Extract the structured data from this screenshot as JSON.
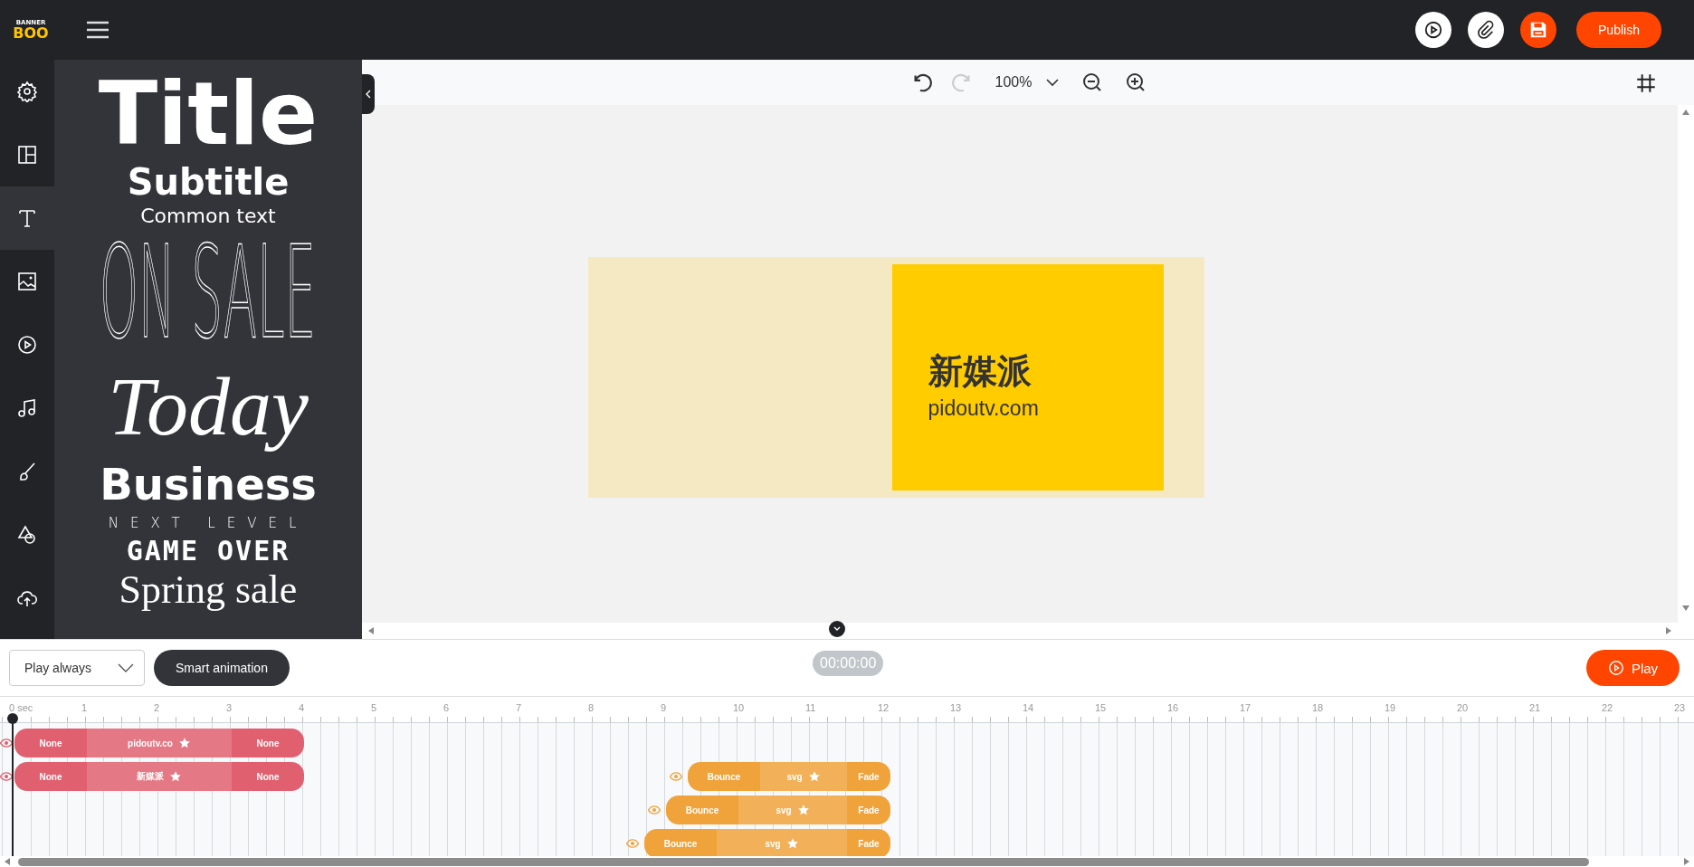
{
  "logo": {
    "line_1": "BANNER",
    "line_2": "BOO"
  },
  "top_bar": {
    "actions": [
      {
        "kind": "preview"
      },
      {
        "kind": "link"
      },
      {
        "kind": "save"
      }
    ],
    "publish": "Publish"
  },
  "rail": [
    {
      "kind": "settings",
      "selected": false
    },
    {
      "kind": "layout",
      "selected": false
    },
    {
      "kind": "text",
      "selected": true
    },
    {
      "kind": "image",
      "selected": false
    },
    {
      "kind": "video",
      "selected": false
    },
    {
      "kind": "music",
      "selected": false
    },
    {
      "kind": "brush",
      "selected": false
    },
    {
      "kind": "shapes",
      "selected": false
    },
    {
      "kind": "upload",
      "selected": false
    }
  ],
  "text_panel": {
    "samples": [
      {
        "kind": "title",
        "text": "Title"
      },
      {
        "kind": "subtitle",
        "text": "Subtitle"
      },
      {
        "kind": "common",
        "text": "Common text"
      },
      {
        "kind": "thin",
        "text": "ON SALE"
      },
      {
        "kind": "script",
        "text": "Today"
      },
      {
        "kind": "business",
        "text": "Business"
      },
      {
        "kind": "spaced",
        "text": "NEXT LEVEL"
      },
      {
        "kind": "pixel",
        "text": "GAME OVER"
      },
      {
        "kind": "serif",
        "text": "Spring sale"
      }
    ]
  },
  "toolbar": {
    "zoom": "100%"
  },
  "banner": {
    "headline": "新媒派",
    "url": "pidoutv.com"
  },
  "controls": {
    "play_mode": "Play always",
    "smart_animation": "Smart animation",
    "time": "00:00:00",
    "play": "Play"
  },
  "ruler": [
    "0 sec",
    "1",
    "2",
    "3",
    "4",
    "5",
    "6",
    "7",
    "8",
    "9",
    "10",
    "11",
    "12",
    "13",
    "14",
    "15",
    "16",
    "17",
    "18",
    "19",
    "20",
    "21",
    "22",
    "23"
  ],
  "tracks": [
    {
      "color": "#e0606f",
      "segments": [
        {
          "kind": "in",
          "label": "None"
        },
        {
          "kind": "main",
          "label": "pidoutv.co"
        },
        {
          "kind": "out",
          "label": "None"
        }
      ]
    },
    {
      "color": "#e0606f",
      "segments": [
        {
          "kind": "in",
          "label": "None"
        },
        {
          "kind": "main",
          "label": "新媒派"
        },
        {
          "kind": "out",
          "label": "None"
        }
      ]
    },
    {
      "color": "#f0a33b",
      "segments": [
        {
          "kind": "in",
          "label": "Bounce"
        },
        {
          "kind": "main",
          "label": "svg"
        },
        {
          "kind": "out",
          "label": "Fade"
        }
      ]
    },
    {
      "color": "#f0a33b",
      "segments": [
        {
          "kind": "in",
          "label": "Bounce"
        },
        {
          "kind": "main",
          "label": "svg"
        },
        {
          "kind": "out",
          "label": "Fade"
        }
      ]
    },
    {
      "color": "#f0a33b",
      "segments": [
        {
          "kind": "in",
          "label": "Bounce"
        },
        {
          "kind": "main",
          "label": "svg"
        },
        {
          "kind": "out",
          "label": "Fade"
        }
      ]
    }
  ]
}
